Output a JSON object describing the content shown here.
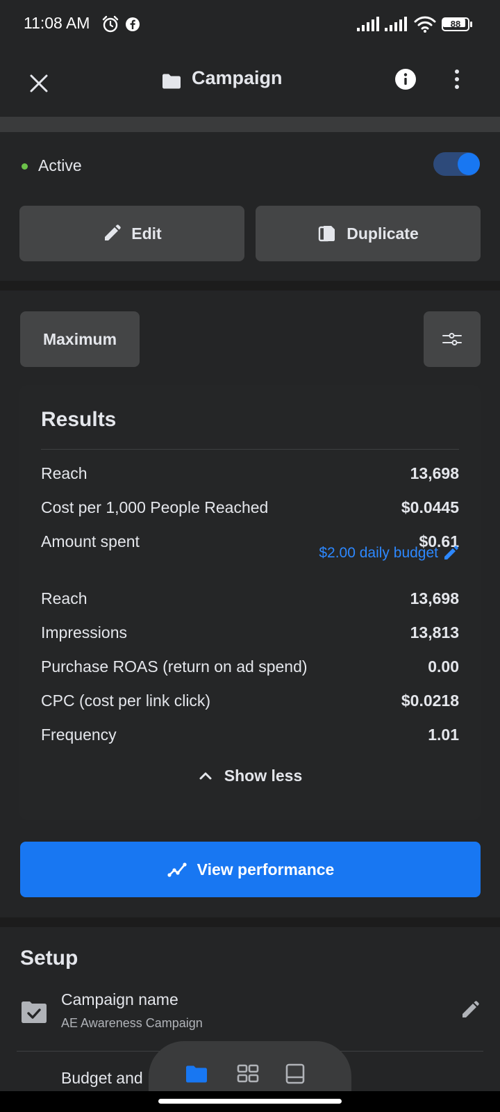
{
  "status_bar": {
    "time": "11:08 AM",
    "battery": "88"
  },
  "header": {
    "title": "Campaign"
  },
  "status": {
    "label": "Active",
    "toggle_on": true,
    "dot_color": "#6cc24a"
  },
  "actions": {
    "edit_label": "Edit",
    "duplicate_label": "Duplicate"
  },
  "filters": {
    "date_range_label": "Maximum"
  },
  "results": {
    "title": "Results",
    "rows": [
      {
        "label": "Reach",
        "value": "13,698"
      },
      {
        "label": "Cost per 1,000 People Reached",
        "value": "$0.0445"
      },
      {
        "label": "Amount spent",
        "value": "$0.61"
      },
      {
        "label": "Reach",
        "value": "13,698"
      },
      {
        "label": "Impressions",
        "value": "13,813"
      },
      {
        "label": "Purchase ROAS (return on ad spend)",
        "value": "0.00"
      },
      {
        "label": "CPC (cost per link click)",
        "value": "$0.0218"
      },
      {
        "label": "Frequency",
        "value": "1.01"
      }
    ],
    "budget_link": "$2.00 daily budget",
    "show_less_label": "Show less"
  },
  "view_performance_label": "View performance",
  "setup": {
    "title": "Setup",
    "campaign_name_label": "Campaign name",
    "campaign_name_value": "AE Awareness Campaign",
    "budget_label": "Budget and"
  },
  "bottom_nav": {
    "items": [
      "folder-icon",
      "grid-icon",
      "ad-preview-icon"
    ],
    "active": "folder-icon"
  },
  "colors": {
    "accent": "#1877f2",
    "link": "#2d88ff",
    "surface": "#242526",
    "button": "#444546"
  }
}
